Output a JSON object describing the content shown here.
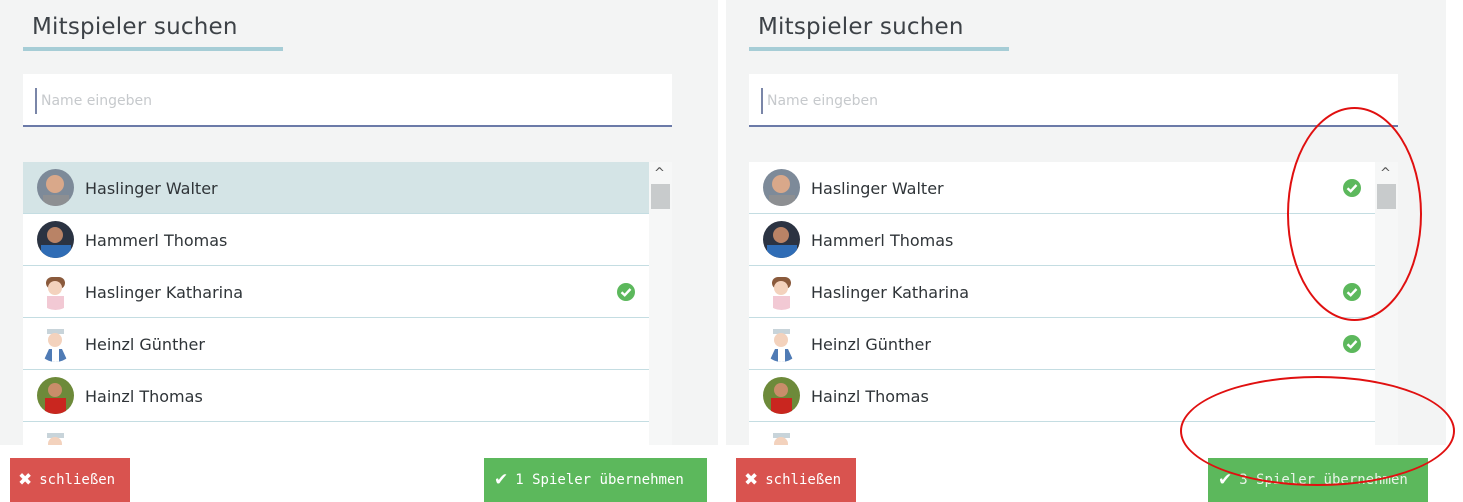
{
  "panels": [
    {
      "title": "Mitspieler suchen",
      "search": {
        "placeholder": "Name eingeben",
        "value": ""
      },
      "players": [
        {
          "name": "Haslinger Walter",
          "avatar": "photo-man-gray-shirt",
          "selected": false,
          "highlighted": true
        },
        {
          "name": "Hammerl Thomas",
          "avatar": "photo-man-blue-shirt",
          "selected": false,
          "highlighted": false
        },
        {
          "name": "Haslinger Katharina",
          "avatar": "female-tennis-player-avatar",
          "selected": true,
          "highlighted": false
        },
        {
          "name": "Heinzl Günther",
          "avatar": "male-tennis-player-avatar",
          "selected": false,
          "highlighted": false
        },
        {
          "name": "Hainzl Thomas",
          "avatar": "photo-man-red-shirt",
          "selected": false,
          "highlighted": false
        }
      ],
      "close_label": "schließen",
      "accept_label": "1 Spieler übernehmen"
    },
    {
      "title": "Mitspieler suchen",
      "search": {
        "placeholder": "Name eingeben",
        "value": ""
      },
      "players": [
        {
          "name": "Haslinger Walter",
          "avatar": "photo-man-gray-shirt",
          "selected": true,
          "highlighted": false
        },
        {
          "name": "Hammerl Thomas",
          "avatar": "photo-man-blue-shirt",
          "selected": false,
          "highlighted": false
        },
        {
          "name": "Haslinger Katharina",
          "avatar": "female-tennis-player-avatar",
          "selected": true,
          "highlighted": false
        },
        {
          "name": "Heinzl Günther",
          "avatar": "male-tennis-player-avatar",
          "selected": true,
          "highlighted": false
        },
        {
          "name": "Hainzl Thomas",
          "avatar": "photo-man-red-shirt",
          "selected": false,
          "highlighted": false
        }
      ],
      "close_label": "schließen",
      "accept_label": "3 Spieler übernehmen"
    }
  ],
  "icons": {
    "close": "times-icon",
    "accept": "check-icon",
    "selected": "check-circle-icon",
    "scroll_up": "chevron-up-icon"
  },
  "colors": {
    "close_button": "#d9534f",
    "accept_button": "#5cb85c",
    "check": "#5cb85c",
    "annotation": "#e01010",
    "title_underline": "#a6cdd6"
  }
}
